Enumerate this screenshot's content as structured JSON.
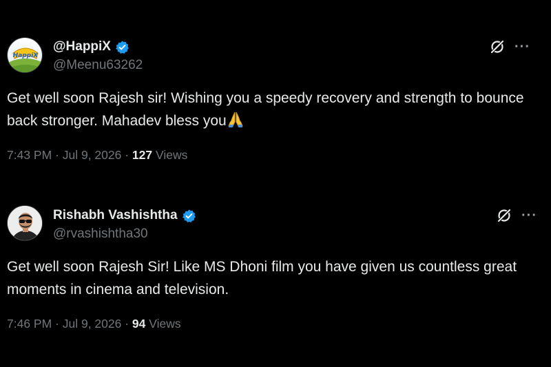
{
  "tweets": [
    {
      "display_name": "@HappiX",
      "handle": "@Meenu63262",
      "avatar_text": "HappiX",
      "text": "Get well soon Rajesh sir! Wishing you a speedy recovery and strength to bounce back stronger. Mahadev bless you",
      "emoji": "folded-hands",
      "time": "7:43 PM · Jul 9, 2026 · ",
      "views_count": "127",
      "views_label": " Views"
    },
    {
      "display_name": "Rishabh Vashishtha",
      "handle": "@rvashishtha30",
      "text": "Get well soon Rajesh Sir! Like MS Dhoni film you have given us countless great moments in cinema and television.",
      "time": "7:46 PM · Jul 9, 2026 · ",
      "views_count": "94",
      "views_label": " Views"
    }
  ],
  "more_label": "···",
  "colors": {
    "background": "#000000",
    "text": "#e7e9ea",
    "muted": "#71767b",
    "verified": "#1d9bf0"
  },
  "icons": [
    "verified-badge-icon",
    "grok-icon",
    "more-icon",
    "folded-hands-emoji"
  ]
}
